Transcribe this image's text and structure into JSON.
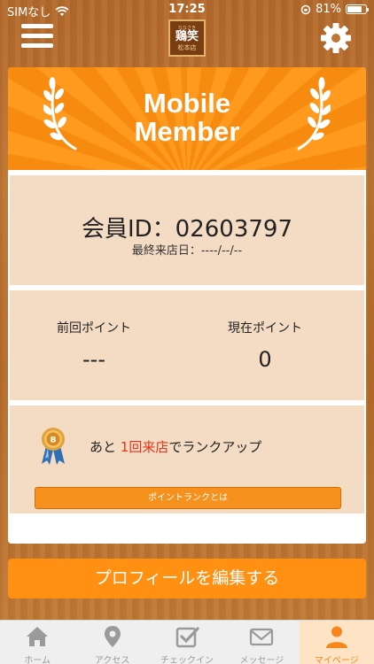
{
  "status_bar": {
    "carrier": "SIMなし",
    "time": "17:25",
    "battery": "81%",
    "battery_level": 0.81
  },
  "header": {
    "logo": {
      "small": "ななさき",
      "main": "鶏笑",
      "sub": "松本店"
    },
    "menu_icon": "hamburger-icon",
    "settings_icon": "gear-icon"
  },
  "banner": {
    "line1": "Mobile",
    "line2": "Member"
  },
  "member": {
    "id_text": "会員ID：02603797",
    "last_visit": "最終来店日：----/--/--"
  },
  "points": {
    "previous_label": "前回ポイント",
    "previous_value": "---",
    "current_label": "現在ポイント",
    "current_value": "0"
  },
  "rank": {
    "text_before": "あと",
    "highlight": "1回来店",
    "text_after": "でランクアップ",
    "button_label": "ポイントランクとは",
    "medal_icon": "medal-icon"
  },
  "edit_profile_label": "プロフィールを編集する",
  "tabs": [
    {
      "label": "ホーム",
      "icon": "home-icon",
      "active": false
    },
    {
      "label": "アクセス",
      "icon": "map-pin-icon",
      "active": false
    },
    {
      "label": "チェックイン",
      "icon": "checkin-icon",
      "active": false
    },
    {
      "label": "メッセージ",
      "icon": "mail-icon",
      "active": false
    },
    {
      "label": "マイページ",
      "icon": "person-icon",
      "active": true
    }
  ],
  "colors": {
    "accent": "#f7911e",
    "highlight_red": "#e8321a",
    "panel": "#f4dcc4",
    "tab_active": "#f7861d"
  }
}
